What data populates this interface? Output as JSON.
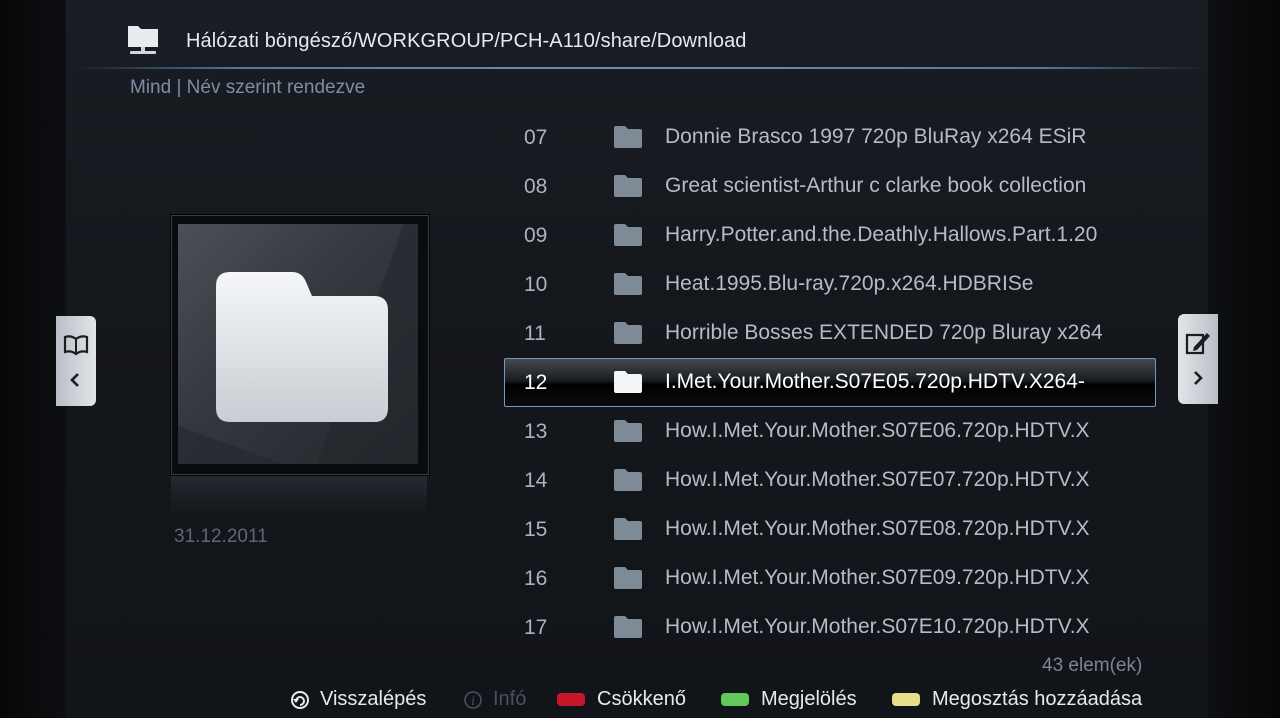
{
  "header": {
    "title": "Hálózati böngésző/WORKGROUP/PCH-A110/share/Download",
    "icon": "network-folder-icon"
  },
  "sort_label": "Mind | Név szerint rendezve",
  "preview": {
    "icon": "folder-icon",
    "date": "31.12.2011"
  },
  "files": [
    {
      "num": "07",
      "name": "Donnie Brasco 1997 720p BluRay x264 ESiR"
    },
    {
      "num": "08",
      "name": "Great scientist-Arthur c clarke book collection"
    },
    {
      "num": "09",
      "name": "Harry.Potter.and.the.Deathly.Hallows.Part.1.20"
    },
    {
      "num": "10",
      "name": "Heat.1995.Blu-ray.720p.x264.HDBRISe"
    },
    {
      "num": "11",
      "name": "Horrible Bosses EXTENDED 720p Bluray x264"
    },
    {
      "num": "12",
      "name": "I.Met.Your.Mother.S07E05.720p.HDTV.X264-"
    },
    {
      "num": "13",
      "name": "How.I.Met.Your.Mother.S07E06.720p.HDTV.X"
    },
    {
      "num": "14",
      "name": "How.I.Met.Your.Mother.S07E07.720p.HDTV.X"
    },
    {
      "num": "15",
      "name": "How.I.Met.Your.Mother.S07E08.720p.HDTV.X"
    },
    {
      "num": "16",
      "name": "How.I.Met.Your.Mother.S07E09.720p.HDTV.X"
    },
    {
      "num": "17",
      "name": "How.I.Met.Your.Mother.S07E10.720p.HDTV.X"
    }
  ],
  "selected_index": 5,
  "item_count": "43 elem(ek)",
  "footer": {
    "back": "Visszalépés",
    "info": "Infó",
    "red": "Csökkenő",
    "green": "Megjelölés",
    "yellow": "Megosztás hozzáadása"
  },
  "colors": {
    "red": "#c8172b",
    "green": "#63c95a",
    "yellow": "#e6df8a",
    "accent": "#5d93bb"
  }
}
